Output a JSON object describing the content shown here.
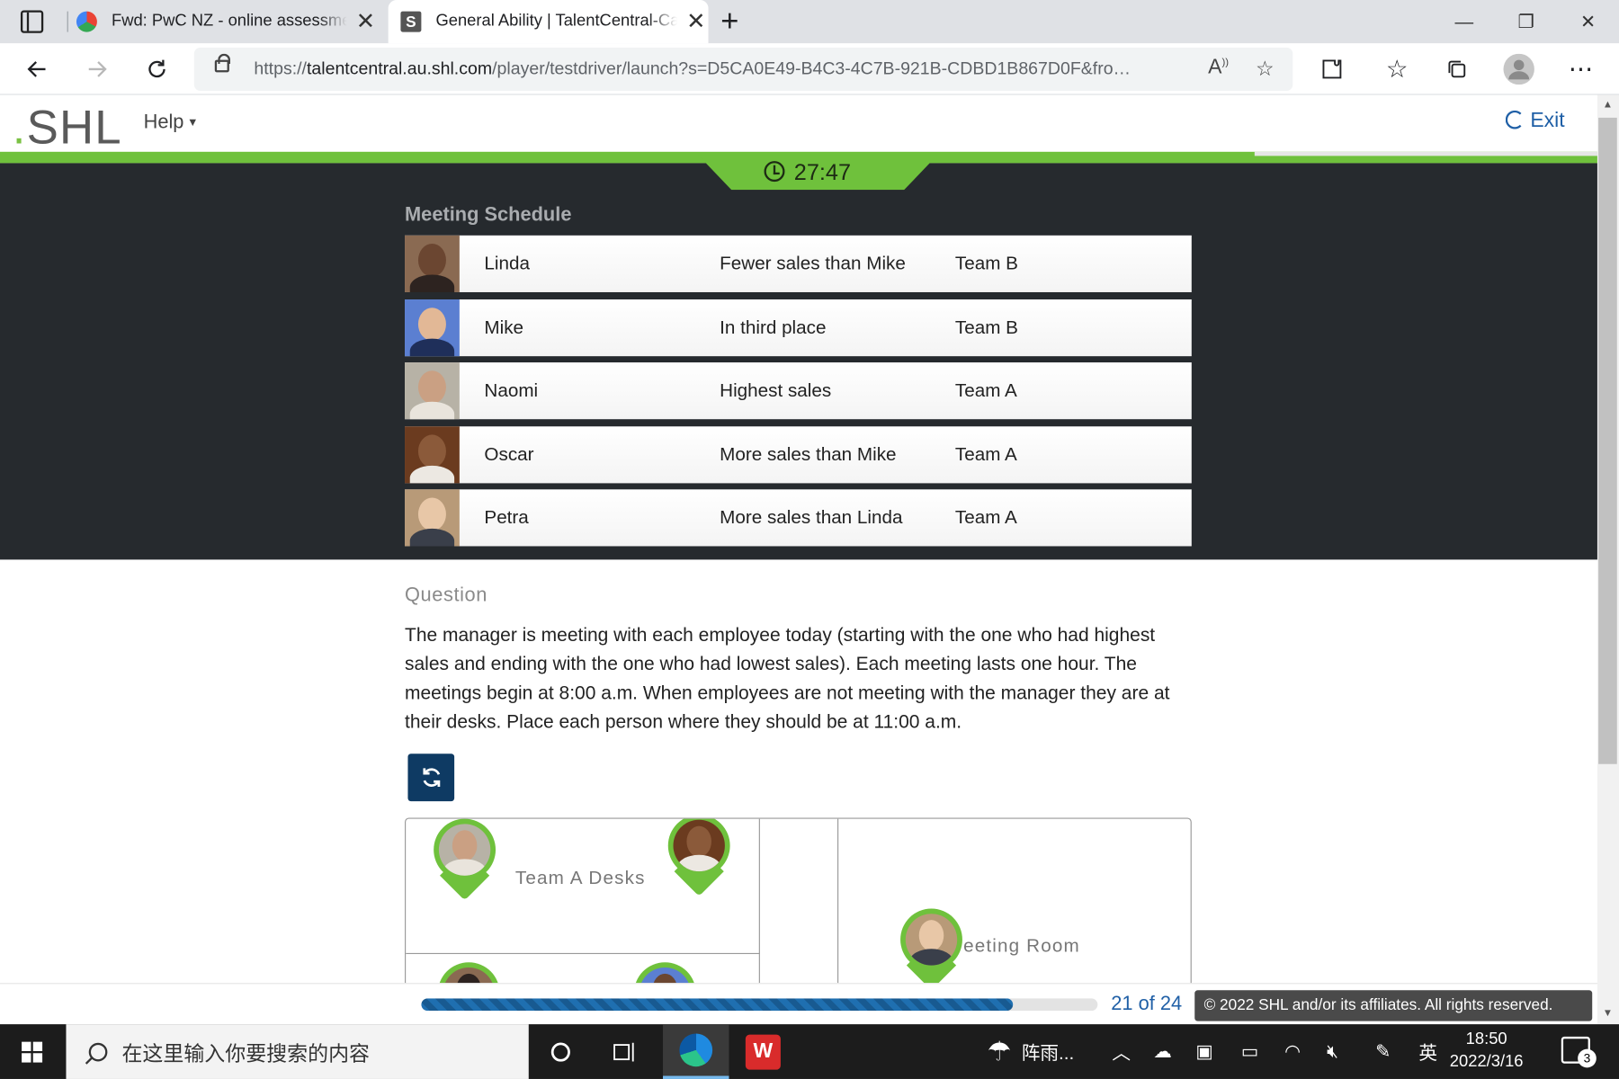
{
  "browser": {
    "tabs": [
      {
        "title": "Fwd: PwC NZ - online assessment",
        "close": "✕"
      },
      {
        "title": "General Ability | TalentCentral-Candidate",
        "favicon_letter": "S",
        "close": "✕"
      }
    ],
    "new_tab": "+",
    "window_controls": {
      "minimize": "—",
      "restore": "❐",
      "close": "✕"
    },
    "url_prefix": "https://",
    "url_host": "talentcentral.au.shl.com",
    "url_path": "/player/testdriver/launch?s=D5CA0E49-B4C3-4C7B-921B-CDBD1B867D0F&fro…"
  },
  "app": {
    "logo": "SHL",
    "logo_dot": ".",
    "help_label": "Help",
    "exit_label": "Exit",
    "timer": "27:47",
    "accent_color": "#6fc13c"
  },
  "schedule": {
    "title": "Meeting Schedule",
    "rows": [
      {
        "name": "Linda",
        "status": "Fewer sales than Mike",
        "team": "Team B"
      },
      {
        "name": "Mike",
        "status": "In third place",
        "team": "Team B"
      },
      {
        "name": "Naomi",
        "status": "Highest sales",
        "team": "Team A"
      },
      {
        "name": "Oscar",
        "status": "More sales than Mike",
        "team": "Team A"
      },
      {
        "name": "Petra",
        "status": "More sales than Linda",
        "team": "Team A"
      }
    ]
  },
  "question": {
    "label": "Question",
    "text": "The manager is meeting with each employee today (starting with the one who had highest sales and ending with the one who had lowest sales). Each meeting lasts one hour. The meetings begin at 8:00 a.m. When employees are not meeting with the manager they are at their desks. Place each person where they should be at 11:00 a.m.",
    "reset_icon": "refresh-icon"
  },
  "board": {
    "team_a_label": "Team A Desks",
    "meeting_room_label": "eeting Room"
  },
  "footer": {
    "progress_text": "21 of 24",
    "progress_fraction": 0.875,
    "copyright": "© 2022 SHL and/or its affiliates. All rights reserved."
  },
  "taskbar": {
    "search_placeholder": "在这里输入你要搜索的内容",
    "weather": "阵雨...",
    "ime": "英",
    "time": "18:50",
    "date": "2022/3/16",
    "notifications": "3"
  }
}
